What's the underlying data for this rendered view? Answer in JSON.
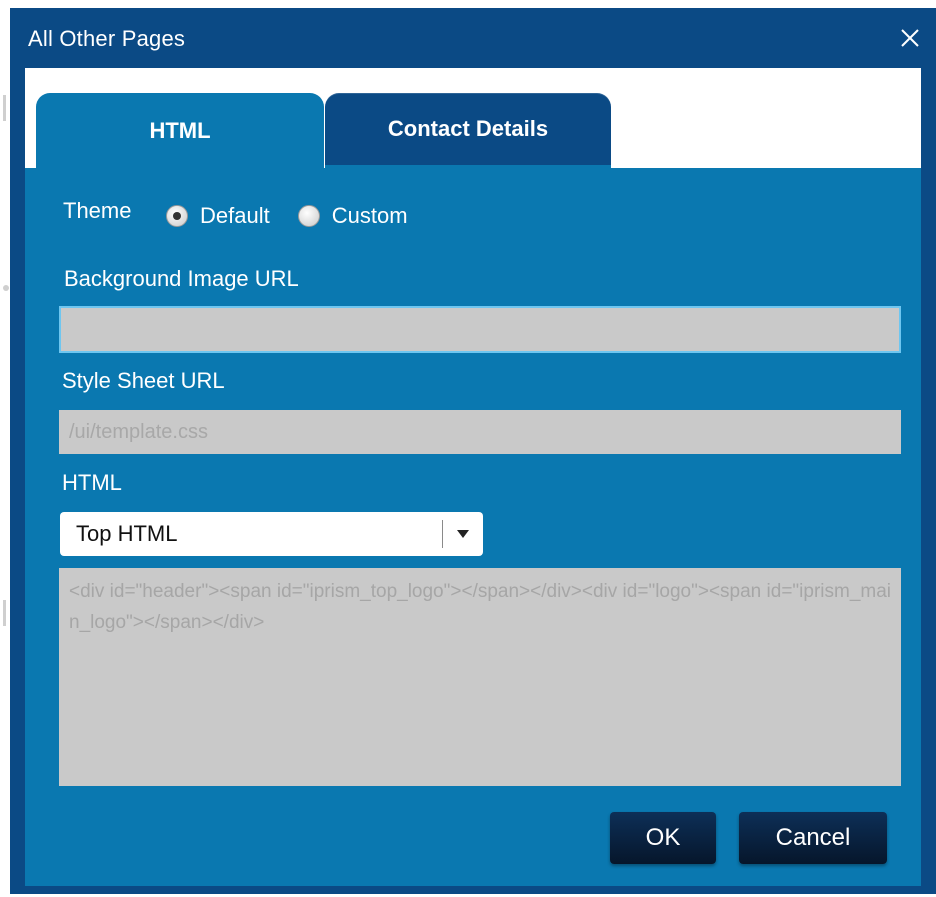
{
  "dialog": {
    "title": "All Other Pages"
  },
  "tabs": [
    {
      "label": "HTML",
      "active": true
    },
    {
      "label": "Contact Details",
      "active": false
    }
  ],
  "form": {
    "theme_label": "Theme",
    "theme_options": [
      {
        "label": "Default",
        "selected": true
      },
      {
        "label": "Custom",
        "selected": false
      }
    ],
    "bg_image_label": "Background Image URL",
    "bg_image_value": "",
    "stylesheet_label": "Style Sheet URL",
    "stylesheet_placeholder": "/ui/template.css",
    "html_label": "HTML",
    "html_select_value": "Top HTML",
    "html_code": "<div id=\"header\"><span id=\"iprism_top_logo\"></span></div><div id=\"logo\"><span id=\"iprism_main_logo\"></span></div>"
  },
  "buttons": {
    "ok": "OK",
    "cancel": "Cancel"
  },
  "colors": {
    "dialog_navy": "#0b4a85",
    "panel_blue": "#0a78b0",
    "input_gray": "#c9c9c9",
    "button_dark": "#06162b"
  }
}
